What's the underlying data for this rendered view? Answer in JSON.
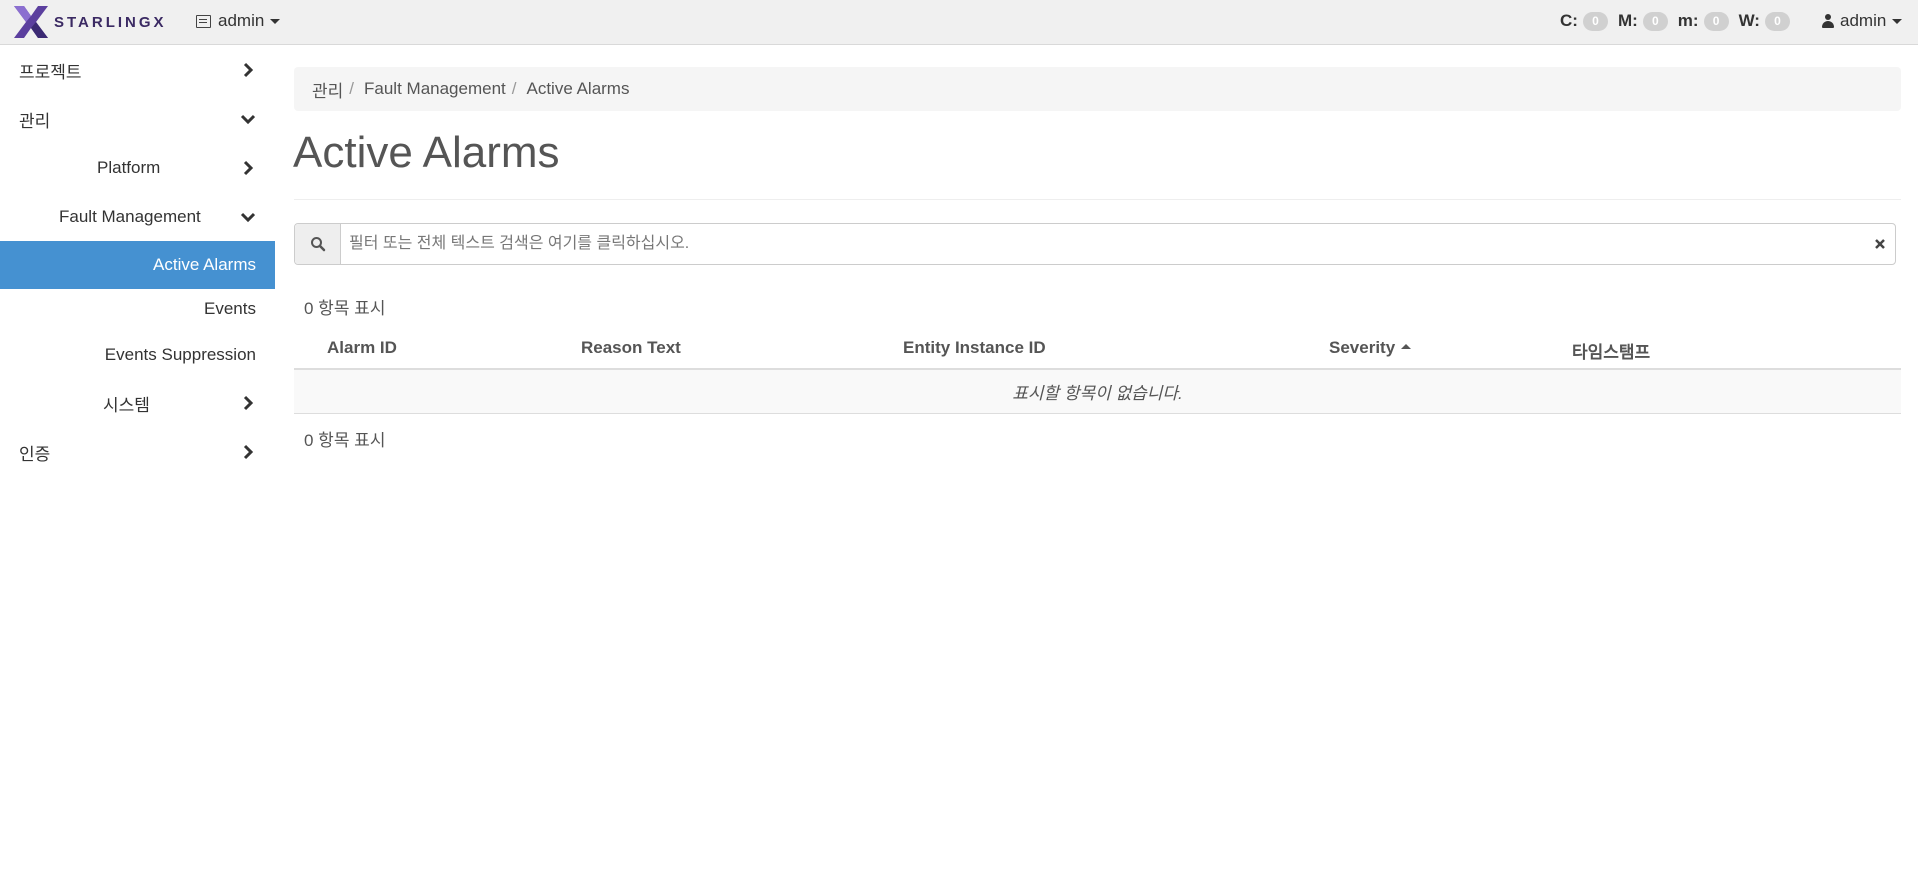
{
  "navbar": {
    "brand": "STARLINGX",
    "project": "admin",
    "alarm_counts": [
      {
        "label": "C:",
        "value": "0"
      },
      {
        "label": "M:",
        "value": "0"
      },
      {
        "label": "m:",
        "value": "0"
      },
      {
        "label": "W:",
        "value": "0"
      }
    ],
    "user": "admin"
  },
  "sidebar": {
    "items": [
      {
        "label": "프로젝트",
        "icon": "chevron-right-icon"
      },
      {
        "label": "관리",
        "icon": "chevron-down-icon"
      },
      {
        "label": "Platform",
        "icon": "chevron-right-icon"
      },
      {
        "label": "Fault Management",
        "icon": "chevron-down-icon"
      },
      {
        "label": "Active Alarms",
        "active": true
      },
      {
        "label": "Events"
      },
      {
        "label": "Events Suppression"
      },
      {
        "label": "시스템",
        "icon": "chevron-right-icon"
      },
      {
        "label": "인증",
        "icon": "chevron-right-icon"
      }
    ],
    "active_color": "#4591d1"
  },
  "breadcrumb": [
    "관리",
    "Fault Management",
    "Active Alarms"
  ],
  "page_title": "Active Alarms",
  "search": {
    "placeholder": "필터 또는 전체 텍스트 검색은 여기를 클릭하십시오."
  },
  "table": {
    "count_top": "0 항목 표시",
    "count_bottom": "0 항목 표시",
    "columns": [
      "Alarm ID",
      "Reason Text",
      "Entity Instance ID",
      "Severity",
      "타임스탬프"
    ],
    "sorted_column": "Severity",
    "empty_message": "표시할 항목이 없습니다."
  }
}
